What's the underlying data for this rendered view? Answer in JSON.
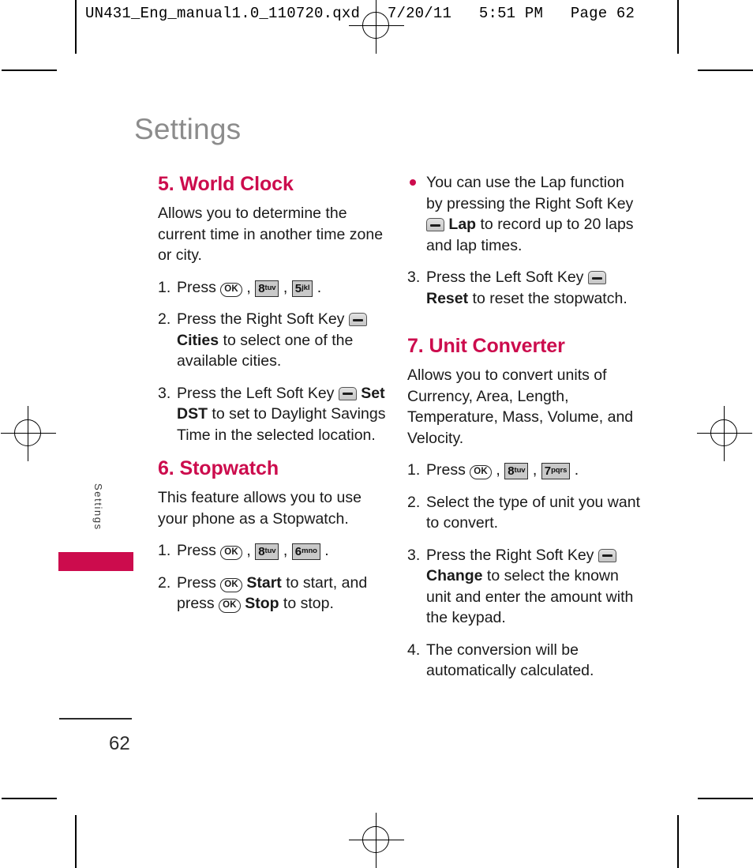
{
  "print_header": "UN431_Eng_manual1.0_110720.qxd   7/20/11   5:51 PM   Page 62",
  "page": {
    "title": "Settings",
    "number": "62",
    "side_tab_label": "Settings",
    "accent_color": "#cc0c4d",
    "title_color": "#8c8c8c"
  },
  "left_column": {
    "sections": [
      {
        "heading": "5. World Clock",
        "intro": "Allows you to determine the current time in another time zone or city.",
        "steps": [
          {
            "num": "1.",
            "parts": [
              {
                "type": "text",
                "value": "Press "
              },
              {
                "type": "key-ok",
                "value": "OK"
              },
              {
                "type": "text",
                "value": " ,  "
              },
              {
                "type": "key-num",
                "digit": "8",
                "letters": "tuv"
              },
              {
                "type": "text",
                "value": " ,  "
              },
              {
                "type": "key-num",
                "digit": "5",
                "letters": "jkl"
              },
              {
                "type": "text",
                "value": " ."
              }
            ]
          },
          {
            "num": "2.",
            "parts": [
              {
                "type": "text",
                "value": "Press the Right Soft Key  "
              },
              {
                "type": "key-soft",
                "value": "soft-key"
              },
              {
                "type": "text",
                "value": " "
              },
              {
                "type": "bold",
                "value": "Cities"
              },
              {
                "type": "text",
                "value": " to select one of the available cities."
              }
            ]
          },
          {
            "num": "3.",
            "parts": [
              {
                "type": "text",
                "value": "Press the Left Soft Key  "
              },
              {
                "type": "key-soft",
                "value": "soft-key"
              },
              {
                "type": "text",
                "value": " "
              },
              {
                "type": "bold",
                "value": "Set DST"
              },
              {
                "type": "text",
                "value": " to set to Daylight Savings Time in the selected location."
              }
            ]
          }
        ]
      },
      {
        "heading": "6. Stopwatch",
        "intro": "This feature allows you to use your phone as a Stopwatch.",
        "steps": [
          {
            "num": "1.",
            "parts": [
              {
                "type": "text",
                "value": "Press "
              },
              {
                "type": "key-ok",
                "value": "OK"
              },
              {
                "type": "text",
                "value": " ,  "
              },
              {
                "type": "key-num",
                "digit": "8",
                "letters": "tuv"
              },
              {
                "type": "text",
                "value": " ,  "
              },
              {
                "type": "key-num",
                "digit": "6",
                "letters": "mno"
              },
              {
                "type": "text",
                "value": " ."
              }
            ]
          },
          {
            "num": "2.",
            "parts": [
              {
                "type": "text",
                "value": "Press "
              },
              {
                "type": "key-ok",
                "value": "OK"
              },
              {
                "type": "text",
                "value": " "
              },
              {
                "type": "bold",
                "value": "Start"
              },
              {
                "type": "text",
                "value": " to start, and press "
              },
              {
                "type": "key-ok",
                "value": "OK"
              },
              {
                "type": "text",
                "value": " "
              },
              {
                "type": "bold",
                "value": "Stop"
              },
              {
                "type": "text",
                "value": " to stop."
              }
            ]
          }
        ]
      }
    ]
  },
  "right_column": {
    "bullets": [
      {
        "parts": [
          {
            "type": "text",
            "value": "You can use the Lap function by pressing the Right Soft Key  "
          },
          {
            "type": "key-soft",
            "value": "soft-key"
          },
          {
            "type": "text",
            "value": " "
          },
          {
            "type": "bold",
            "value": "Lap"
          },
          {
            "type": "text",
            "value": " to record up to 20 laps and lap times."
          }
        ]
      }
    ],
    "continued_steps": [
      {
        "num": "3.",
        "parts": [
          {
            "type": "text",
            "value": "Press the Left Soft Key "
          },
          {
            "type": "key-soft",
            "value": "soft-key"
          },
          {
            "type": "text",
            "value": " "
          },
          {
            "type": "bold",
            "value": "Reset"
          },
          {
            "type": "text",
            "value": " to reset the stopwatch."
          }
        ]
      }
    ],
    "sections": [
      {
        "heading": "7. Unit Converter",
        "intro": "Allows you to convert units of Currency, Area, Length, Temperature, Mass, Volume, and Velocity.",
        "steps": [
          {
            "num": "1.",
            "parts": [
              {
                "type": "text",
                "value": "Press "
              },
              {
                "type": "key-ok",
                "value": "OK"
              },
              {
                "type": "text",
                "value": " ,  "
              },
              {
                "type": "key-num",
                "digit": "8",
                "letters": "tuv"
              },
              {
                "type": "text",
                "value": " ,  "
              },
              {
                "type": "key-num",
                "digit": "7",
                "letters": "pqrs"
              },
              {
                "type": "text",
                "value": " ."
              }
            ]
          },
          {
            "num": "2.",
            "parts": [
              {
                "type": "text",
                "value": "Select the type of unit you want to convert."
              }
            ]
          },
          {
            "num": "3.",
            "parts": [
              {
                "type": "text",
                "value": "Press the Right Soft Key  "
              },
              {
                "type": "key-soft",
                "value": "soft-key"
              },
              {
                "type": "text",
                "value": " "
              },
              {
                "type": "bold",
                "value": "Change"
              },
              {
                "type": "text",
                "value": " to select the known unit and enter the amount with the keypad."
              }
            ]
          },
          {
            "num": "4.",
            "parts": [
              {
                "type": "text",
                "value": "The conversion will be automatically calculated."
              }
            ]
          }
        ]
      }
    ]
  }
}
